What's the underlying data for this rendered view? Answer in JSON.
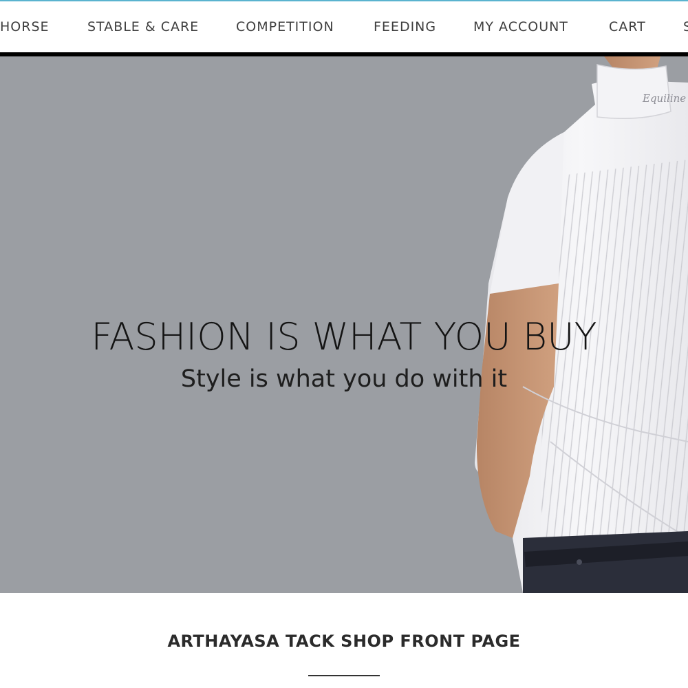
{
  "nav": {
    "items": [
      {
        "label": "HORSE"
      },
      {
        "label": "STABLE & CARE"
      },
      {
        "label": "COMPETITION"
      },
      {
        "label": "FEEDING"
      },
      {
        "label": "MY ACCOUNT"
      },
      {
        "label": "CART"
      },
      {
        "label": "S"
      }
    ]
  },
  "hero": {
    "title": "FASHION IS WHAT YOU BUY",
    "subtitle": "Style is what you do with it",
    "collar_logo": "Equiline",
    "background_color": "#9b9ea3"
  },
  "section": {
    "title": "ARTHAYASA TACK SHOP FRONT PAGE"
  },
  "colors": {
    "accent": "#5ab3cf",
    "nav_text": "#3f3f3f",
    "rule": "#000000"
  }
}
